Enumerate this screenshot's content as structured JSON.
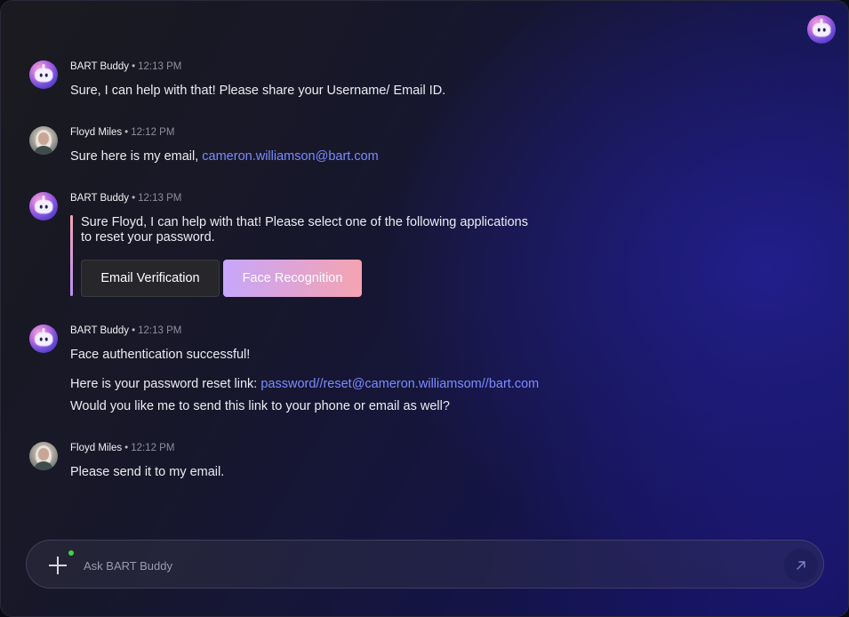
{
  "header": {
    "bot_icon": "bot-avatar-icon"
  },
  "messages": [
    {
      "sender": "BART Buddy",
      "time": "12:13 PM",
      "text": "Sure, I can help with that! Please share your Username/ Email ID."
    },
    {
      "sender": "Floyd Miles",
      "time": "12:12 PM",
      "text_prefix": "Sure here is my email, ",
      "link": "cameron.williamson@bart.com"
    },
    {
      "sender": "BART Buddy",
      "time": "12:13 PM",
      "text_line1": "Sure Floyd, I can help with that! Please select one of the following applications",
      "text_line2": "to reset your password.",
      "options": [
        "Email Verification",
        "Face Recognition"
      ]
    },
    {
      "sender": "BART Buddy",
      "time": "12:13 PM",
      "line1": "Face authentication successful!",
      "line2_prefix": "Here is your password reset link: ",
      "line2_link": "password//reset@cameron.williamsom//bart.com",
      "line3": "Would you like me to send this link to your phone or email as well?"
    },
    {
      "sender": "Floyd Miles",
      "time": "12:12 PM",
      "text": "Please send it to my email."
    }
  ],
  "separator": "•",
  "composer": {
    "placeholder": "Ask BART Buddy",
    "add_icon": "plus-icon",
    "send_icon": "send-arrow-icon"
  },
  "colors": {
    "link": "#7b8cff",
    "accent_start": "#c7a6fb",
    "accent_end": "#f5a3b0",
    "online": "#3fd24a"
  }
}
